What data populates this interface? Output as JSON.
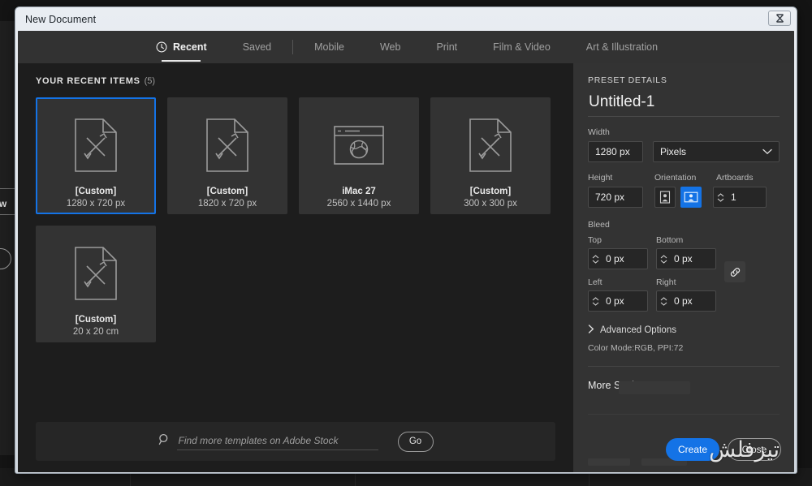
{
  "window": {
    "title": "New Document",
    "close_label": "Close window",
    "close_icon": "close-icon"
  },
  "background": {
    "app_label": "ew",
    "note": "partially visible application behind the dialog"
  },
  "tabs": [
    {
      "label": "Recent",
      "icon": "clock-icon",
      "active": true
    },
    {
      "label": "Saved",
      "icon": "",
      "active": false
    },
    {
      "label": "Mobile",
      "icon": "",
      "active": false
    },
    {
      "label": "Web",
      "icon": "",
      "active": false
    },
    {
      "label": "Print",
      "icon": "",
      "active": false
    },
    {
      "label": "Film & Video",
      "icon": "",
      "active": false
    },
    {
      "label": "Art & Illustration",
      "icon": "",
      "active": false
    }
  ],
  "recent": {
    "heading": "YOUR RECENT ITEMS",
    "count": "(5)",
    "items": [
      {
        "name": "[Custom]",
        "dimensions": "1280 x 720 px",
        "icon": "document-custom-icon",
        "selected": true
      },
      {
        "name": "[Custom]",
        "dimensions": "1820 x 720 px",
        "icon": "document-custom-icon",
        "selected": false
      },
      {
        "name": "iMac 27",
        "dimensions": "2560 x 1440 px",
        "icon": "browser-globe-icon",
        "selected": false
      },
      {
        "name": "[Custom]",
        "dimensions": "300 x 300 px",
        "icon": "document-custom-icon",
        "selected": false
      },
      {
        "name": "[Custom]",
        "dimensions": "20 x 20 cm",
        "icon": "document-custom-icon",
        "selected": false
      }
    ]
  },
  "search": {
    "placeholder": "Find more templates on Adobe Stock",
    "value": "",
    "icon": "search-icon",
    "go_label": "Go"
  },
  "preset": {
    "heading": "PRESET DETAILS",
    "name_value": "Untitled-1",
    "width_label": "Width",
    "width_value": "1280 px",
    "units_value": "Pixels",
    "units_icon": "chevron-down-icon",
    "height_label": "Height",
    "height_value": "720 px",
    "orientation_label": "Orientation",
    "orientation_portrait_icon": "portrait-orientation-icon",
    "orientation_landscape_icon": "landscape-orientation-icon",
    "orientation_selected": "landscape",
    "artboards_label": "Artboards",
    "artboards_value": "1",
    "bleed_label": "Bleed",
    "bleed_top_label": "Top",
    "bleed_top_value": "0 px",
    "bleed_bottom_label": "Bottom",
    "bleed_bottom_value": "0 px",
    "bleed_left_label": "Left",
    "bleed_left_value": "0 px",
    "bleed_right_label": "Right",
    "bleed_right_value": "0 px",
    "link_icon": "link-chain-icon",
    "advanced_label": "Advanced Options",
    "advanced_icon": "chevron-right-icon",
    "color_mode": "Color Mode:RGB, PPI:72",
    "more_settings": "More Settings"
  },
  "actions": {
    "create_label": "Create",
    "close_label": "Close",
    "watermark_text": "تیزفلش"
  },
  "colors": {
    "accent": "#1473e6",
    "panel_bg": "#333333",
    "canvas_bg": "#1d1d1d",
    "tabbar_bg": "#323232",
    "card_bg": "#333333",
    "text_primary": "#ededed",
    "text_muted": "#b8b8b8"
  }
}
